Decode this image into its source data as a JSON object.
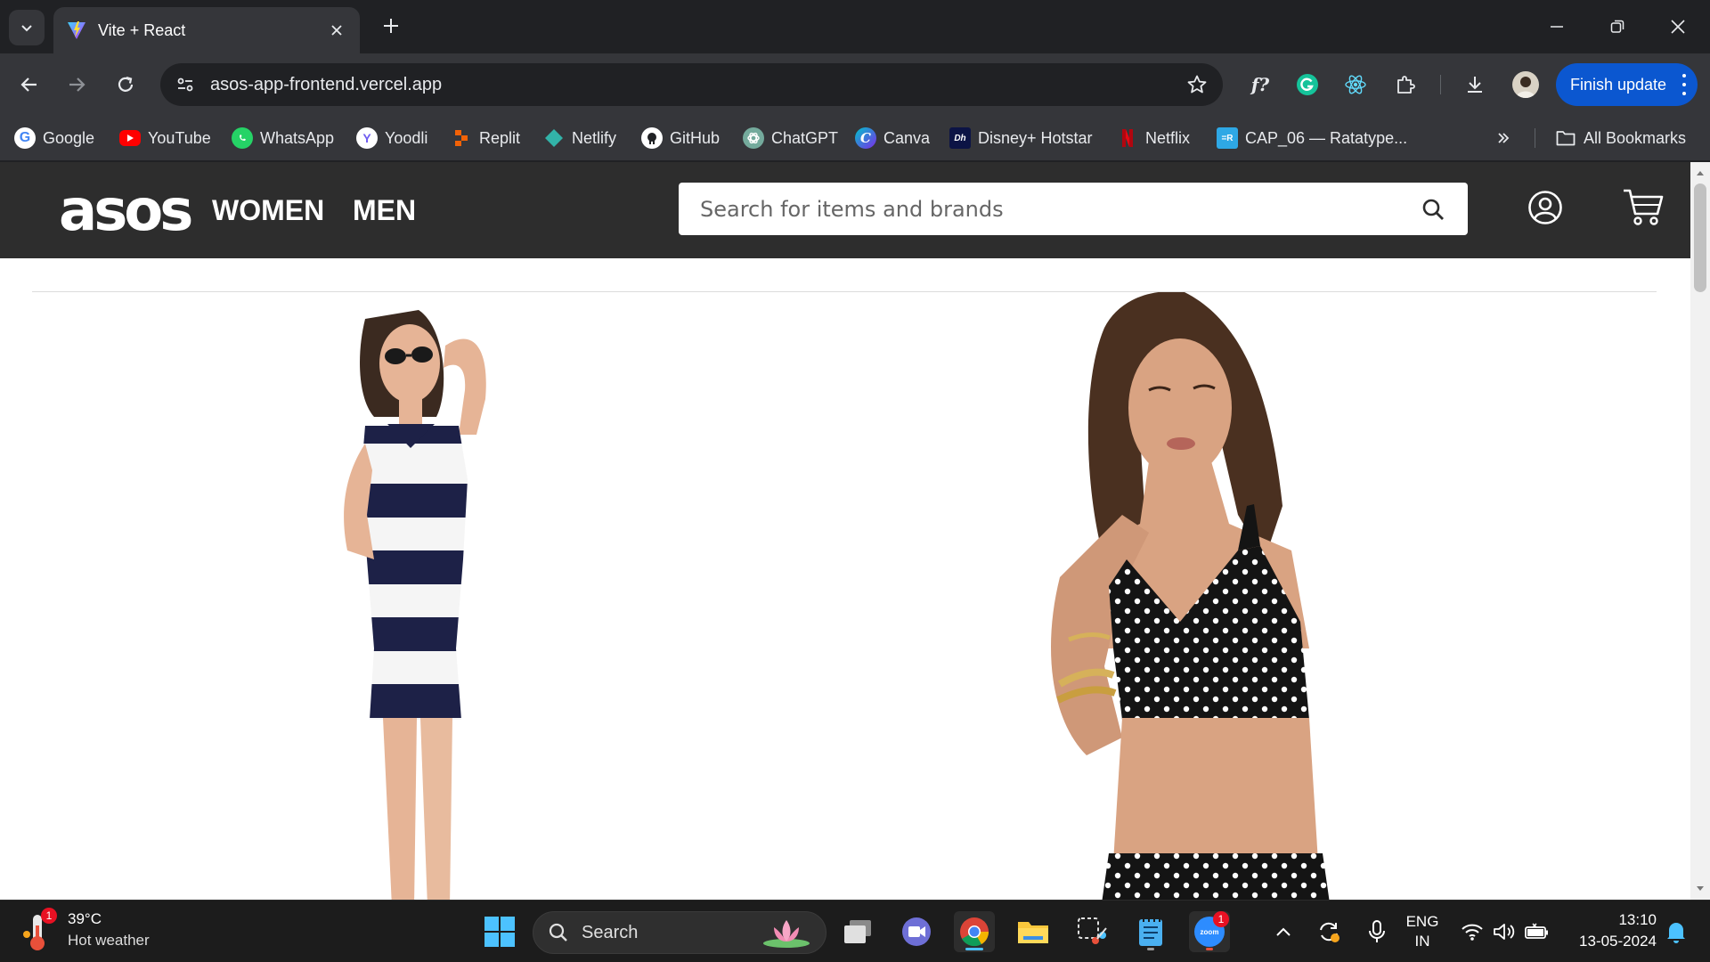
{
  "browser": {
    "tab": {
      "title": "Vite + React"
    },
    "url": "asos-app-frontend.vercel.app",
    "update_button": "Finish update",
    "bookmarks": [
      {
        "label": "Google",
        "icon": "google-icon",
        "color": "#ffffff"
      },
      {
        "label": "YouTube",
        "icon": "youtube-icon",
        "color": "#ff0000"
      },
      {
        "label": "WhatsApp",
        "icon": "whatsapp-icon",
        "color": "#25d366"
      },
      {
        "label": "Yoodli",
        "icon": "yoodli-icon",
        "color": "#6f5cf1"
      },
      {
        "label": "Replit",
        "icon": "replit-icon",
        "color": "#f26207"
      },
      {
        "label": "Netlify",
        "icon": "netlify-icon",
        "color": "#32e6b7"
      },
      {
        "label": "GitHub",
        "icon": "github-icon",
        "color": "#ffffff"
      },
      {
        "label": "ChatGPT",
        "icon": "chatgpt-icon",
        "color": "#74aa9c"
      },
      {
        "label": "Canva",
        "icon": "canva-icon",
        "color": "#00c4cc"
      },
      {
        "label": "Disney+ Hotstar",
        "icon": "hotstar-icon",
        "color": "#0c1445"
      },
      {
        "label": "Netflix",
        "icon": "netflix-icon",
        "color": "#e50914"
      },
      {
        "label": "CAP_06 — Ratatype...",
        "icon": "ratatype-icon",
        "color": "#2ea8e5"
      }
    ],
    "all_bookmarks": "All Bookmarks"
  },
  "site": {
    "logo": "asos",
    "nav": [
      "WOMEN",
      "MEN"
    ],
    "search_placeholder": "Search for items and brands"
  },
  "taskbar": {
    "weather": {
      "temp": "39°C",
      "desc": "Hot weather",
      "badge": "1"
    },
    "search_label": "Search",
    "zoom_badge": "1",
    "lang": {
      "top": "ENG",
      "bottom": "IN"
    },
    "time": "13:10",
    "date": "13-05-2024"
  },
  "colors": {
    "header_bg": "#2d2d2d",
    "update_button": "#0b57d0"
  }
}
